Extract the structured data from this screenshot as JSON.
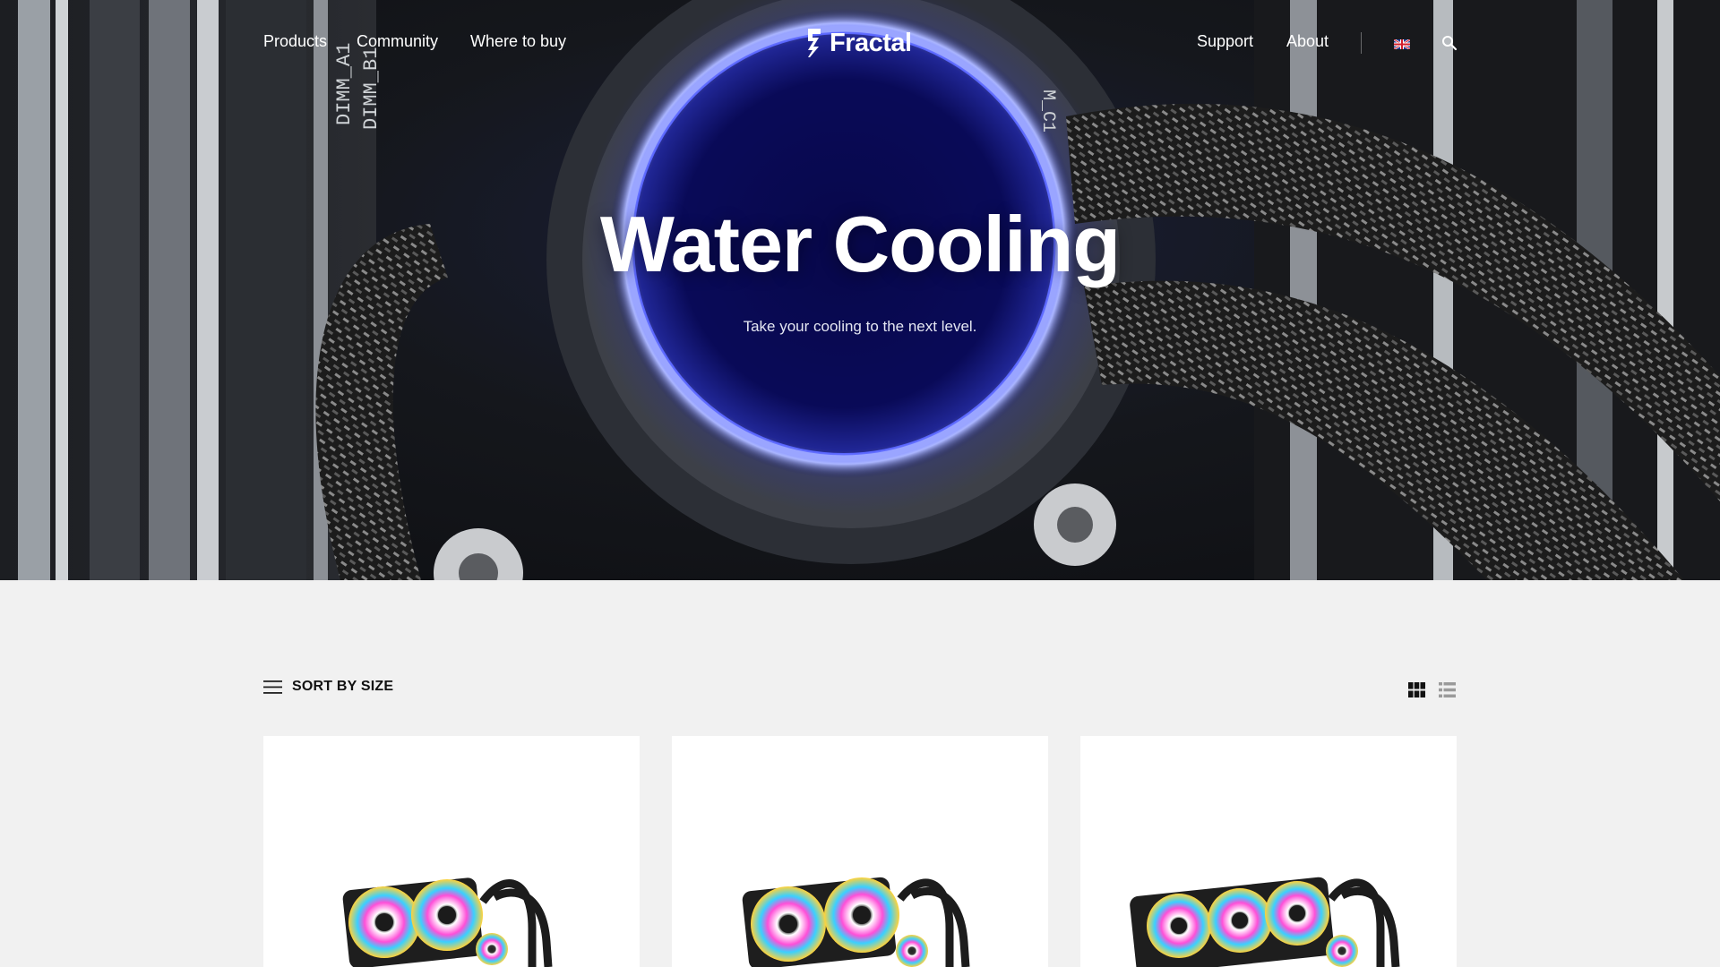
{
  "header": {
    "logo_text": "Fractal",
    "nav_left": [
      "Products",
      "Community",
      "Where to buy"
    ],
    "nav_right": [
      "Support",
      "About"
    ],
    "flag_icon": "uk-flag-icon",
    "search_icon": "search-icon"
  },
  "hero": {
    "title": "Water Cooling",
    "subtitle": "Take your cooling to the next level."
  },
  "toolbar": {
    "sort_label": "SORT BY SIZE",
    "sort_icon": "menu-lines-icon",
    "view_modes": [
      "grid-view-icon",
      "list-view-icon"
    ],
    "active_view": "grid"
  },
  "products": [
    {
      "fans": 2
    },
    {
      "fans": 2
    },
    {
      "fans": 3
    }
  ],
  "colors": {
    "accent_ring": "#5b6bff",
    "page_bg": "#f1f1f1",
    "card_bg": "#ffffff"
  }
}
